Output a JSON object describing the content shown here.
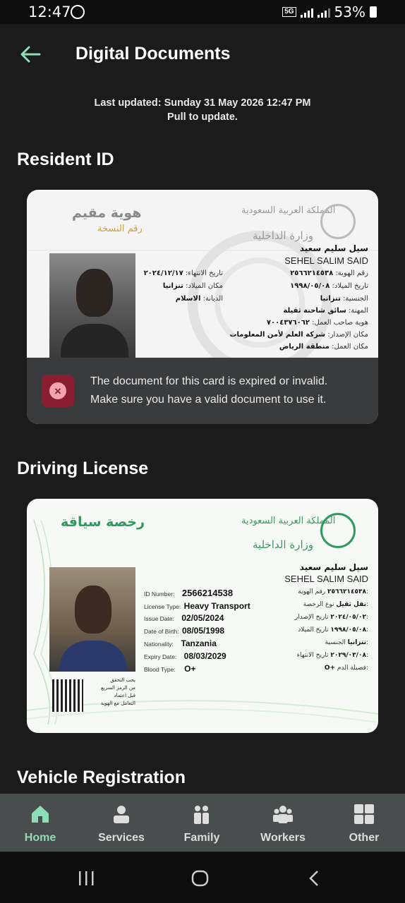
{
  "status_bar": {
    "time": "12:47",
    "network": "5G",
    "battery_percent": "53%",
    "icons": [
      "whatsapp-icon",
      "signal-icon",
      "battery-icon"
    ]
  },
  "header": {
    "title": "Digital Documents",
    "back_icon": "arrow-left-icon"
  },
  "update_info": {
    "line1": "Last updated: Sunday 31 May 2026 12:47 PM",
    "line2": "Pull to update."
  },
  "sections": {
    "resident_id": "Resident ID",
    "driving_license": "Driving License",
    "vehicle_registration": "Vehicle Registration"
  },
  "resident_card": {
    "title_ar": "هوية مقيم",
    "subtitle_ar": "رقم النسخة",
    "kingdom_ar": "المملكة العربية السعودية",
    "ministry_ar": "وزارة الداخلية",
    "name_ar": "سيل سليم سعيد",
    "name_en": "SEHEL SALIM SAID",
    "rows": [
      {
        "label": "رقم الهوية:",
        "value": "٢٥٦٦٢١٤٥٣٨"
      },
      {
        "label": "تاريخ الميلاد:",
        "value": "١٩٩٨/٠٥/٠٨"
      },
      {
        "label": "الجنسية:",
        "value": "تنزانيا"
      },
      {
        "label": "المهنة:",
        "value": "سائق شاحنة ثقيلة"
      },
      {
        "label": "هوية صاحب العمل:",
        "value": "٧٠٠٤٣٧٦٠٦٢"
      },
      {
        "label": "مكان الإصدار:",
        "value": "شركة العلم لأمن المعلومات"
      },
      {
        "label": "مكان العمل:",
        "value": "منطقة الرياض"
      }
    ],
    "rows_mid": [
      {
        "label": "تاريخ الانتهاء:",
        "value": "٢٠٢٤/١٢/١٧"
      },
      {
        "label": "مكان الميلاد:",
        "value": "تنزانيا"
      },
      {
        "label": "الديانة:",
        "value": "الاسلام"
      }
    ]
  },
  "error_overlay": {
    "icon": "error-x-icon",
    "line1": "The document for this card is expired or invalid.",
    "line2": "Make sure you have a valid document to use it."
  },
  "license_card": {
    "title_ar": "رخصة سياقة",
    "kingdom_ar": "المملكة العربية السعودية",
    "ministry_ar": "وزارة الداخلية",
    "name_ar": "سيل سليم سعيد",
    "name_en": "SEHEL SALIM SAID",
    "fields_en": [
      {
        "label": "ID Number:",
        "value": "2566214538"
      },
      {
        "label": "License Type:",
        "value": "Heavy Transport"
      },
      {
        "label": "Issue Date:",
        "value": "02/05/2024"
      },
      {
        "label": "Date of Birth:",
        "value": "08/05/1998"
      },
      {
        "label": "Nationality:",
        "value": "Tanzania"
      },
      {
        "label": "Expiry Date:",
        "value": "08/03/2029"
      },
      {
        "label": "Blood Type:",
        "value": "O+"
      }
    ],
    "fields_ar": [
      {
        "label": "رقم الهوية:",
        "value": "٢٥٦٦٢١٤٥٣٨"
      },
      {
        "label": "نوع الرخصة:",
        "value": "نقل ثقيل"
      },
      {
        "label": "تاريخ الإصدار:",
        "value": "٢٠٢٤/٠٥/٠٢"
      },
      {
        "label": "تاريخ الميلاد:",
        "value": "١٩٩٨/٠٥/٠٨"
      },
      {
        "label": "الجنسية:",
        "value": "تنزانيا"
      },
      {
        "label": "تاريخ الانتهاء:",
        "value": "٢٠٢٩/٠٣/٠٨"
      },
      {
        "label": "فصيلة الدم:",
        "value": "O+"
      }
    ],
    "qr_note_ar": [
      "يجب التحقق",
      "من الرمز السريع",
      "قبل اعتماد",
      "التعامل مع الهوية"
    ]
  },
  "bottom_nav": {
    "items": [
      {
        "label": "Home",
        "icon": "home-icon",
        "active": true
      },
      {
        "label": "Services",
        "icon": "person-icon",
        "active": false
      },
      {
        "label": "Family",
        "icon": "family-icon",
        "active": false
      },
      {
        "label": "Workers",
        "icon": "workers-icon",
        "active": false
      },
      {
        "label": "Other",
        "icon": "grid-icon",
        "active": false
      }
    ]
  },
  "colors": {
    "background": "#1b1b1b",
    "accent_green": "#8fdcb9",
    "nav_bar": "#4a4d4d",
    "error_red": "#8b1d32",
    "overlay": "#3a3b3c"
  }
}
